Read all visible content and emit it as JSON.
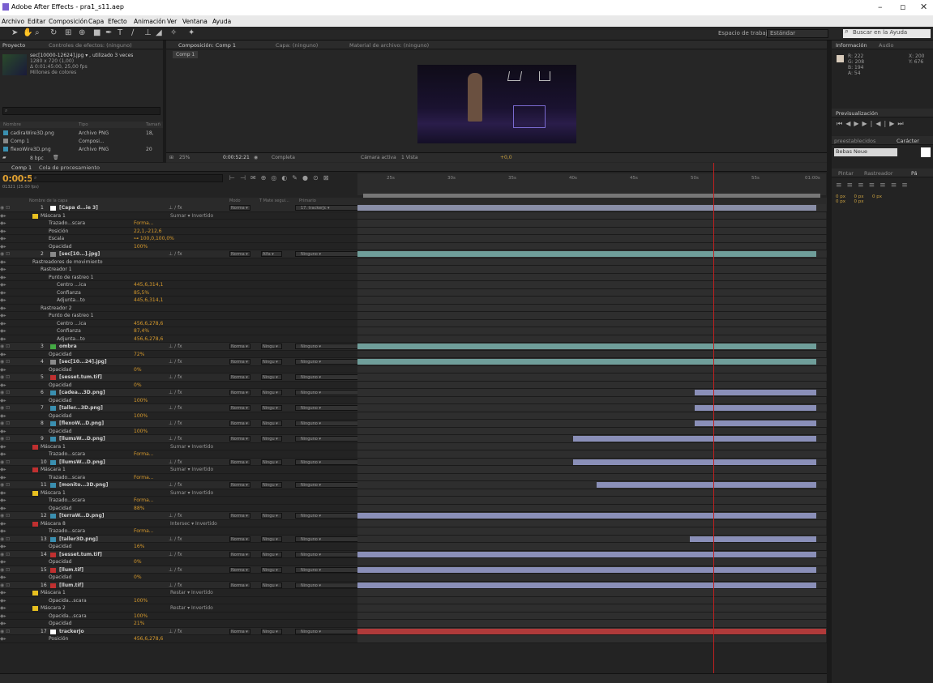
{
  "window": {
    "title": "Adobe After Effects - pra1_s11.aep"
  },
  "menu": [
    "Archivo",
    "Editar",
    "Composición",
    "Capa",
    "Efecto",
    "Animación",
    "Ver",
    "Ventana",
    "Ayuda"
  ],
  "toolbar": {
    "workspace_label": "Espacio de trabajo:",
    "workspace_value": "Estándar",
    "help_placeholder": "Buscar en la Ayuda"
  },
  "project": {
    "tab_project": "Proyecto",
    "tab_effects": "Controles de efectos: (ninguno)",
    "file_name": "sec[10000-12624].jpg ▾ , utilizado 3 veces",
    "file_dims": "1280 x 720 (1,00)",
    "file_dur": "Δ 0:01:45:00, 25,00 fps",
    "file_colors": "Millones de colores",
    "col_name": "Nombre",
    "col_type": "Tipo",
    "col_size": "Tamañ",
    "items": [
      {
        "name": "cadiraWire3D.png",
        "type": "Archivo PNG",
        "size": "18,"
      },
      {
        "name": "Comp 1",
        "type": "Composi...",
        "size": ""
      },
      {
        "name": "flexoWire3D.png",
        "type": "Archivo PNG",
        "size": "20"
      }
    ],
    "bpc": "8 bpc"
  },
  "composition": {
    "tab_comp": "Composición: Comp 1",
    "tab_layer": "Capa: (ninguno)",
    "tab_footage": "Material de archivo: (ninguno)",
    "comp_name": "Comp 1",
    "zoom": "25%",
    "time": "0:00:52:21",
    "quality": "Completa",
    "camera": "Cámara activa",
    "views": "1 Vista",
    "exposure": "+0,0"
  },
  "info": {
    "tab": "Información",
    "tab2": "Audio",
    "r": "R: 222",
    "g": "G: 208",
    "b": "B: 194",
    "a": "A: 54",
    "x": "X: 200",
    "y": "Y: 676",
    "swatch": "#d8cbbb"
  },
  "preview": {
    "tab": "Previsualización"
  },
  "presets": {
    "tab": "preestablecidos",
    "char_tab": "Carácter",
    "font": "Bebas Neue"
  },
  "paragraph": {
    "tab1": "Pintar",
    "tab2": "Rastreador",
    "tab3": "Pá",
    "vals": [
      "0 px",
      "0 px",
      "0 px",
      "0 px",
      "0 px"
    ]
  },
  "timeline": {
    "tab": "Comp 1",
    "tab2": "Cola de procesamiento",
    "timecode": "0:00:52:21",
    "fps": "01321 (25.00 fps)",
    "cols": {
      "name": "Nombre de la capa",
      "mode": "Modo",
      "trk": "T  Mate segui...",
      "parent": "Primario"
    },
    "ruler": [
      "25s",
      "30s",
      "35s",
      "40s",
      "45s",
      "50s",
      "55s",
      "01:00s"
    ]
  },
  "rows": [
    {
      "k": "layer",
      "num": "1",
      "name": "[Capa d...ie 3]",
      "chip": "#ffffff",
      "mode": "Norma",
      "parent": "17. trackerJc",
      "bar": [
        0,
        0.98
      ],
      "barc": "#8a8fa8"
    },
    {
      "k": "sub",
      "ind": 2,
      "name": "Máscara 1",
      "chip": "#e8c020",
      "extra": "Sumar ▾   Invertido"
    },
    {
      "k": "prop",
      "ind": 3,
      "name": "Trazado...scara",
      "val": "Forma..."
    },
    {
      "k": "prop",
      "ind": 3,
      "name": "Posición",
      "val": "22,1,-212,6"
    },
    {
      "k": "prop",
      "ind": 3,
      "name": "Escala",
      "val": "⊶ 100,0,100,0%"
    },
    {
      "k": "prop",
      "ind": 3,
      "name": "Opacidad",
      "val": "100%"
    },
    {
      "k": "layer",
      "num": "2",
      "name": "[sec[10...].jpg]",
      "chip": "#8a8a8a",
      "mode": "Norma",
      "trk": "Alfa",
      "parent": "Ninguno",
      "bar": [
        0,
        0.98
      ],
      "barc": "#6f9e9a"
    },
    {
      "k": "sub",
      "ind": 1,
      "name": "Rastreadores de movimiento"
    },
    {
      "k": "sub",
      "ind": 2,
      "name": "Rastreador 1"
    },
    {
      "k": "sub",
      "ind": 3,
      "name": "Punto de rastreo 1"
    },
    {
      "k": "prop",
      "ind": 4,
      "name": "Centro ...ica",
      "val": "445,6,314,1"
    },
    {
      "k": "prop",
      "ind": 4,
      "name": "Confianza",
      "val": "85,5%"
    },
    {
      "k": "prop",
      "ind": 4,
      "name": "Adjunta...to",
      "val": "445,6,314,1"
    },
    {
      "k": "sub",
      "ind": 2,
      "name": "Rastreador 2"
    },
    {
      "k": "sub",
      "ind": 3,
      "name": "Punto de rastreo 1"
    },
    {
      "k": "prop",
      "ind": 4,
      "name": "Centro ...ica",
      "val": "456,6,278,6"
    },
    {
      "k": "prop",
      "ind": 4,
      "name": "Confianza",
      "val": "87,4%"
    },
    {
      "k": "prop",
      "ind": 4,
      "name": "Adjunta...to",
      "val": "456,6,278,6"
    },
    {
      "k": "layer",
      "num": "3",
      "name": "ombra",
      "chip": "#44aa44",
      "mode": "Norma",
      "trk": "Ningu",
      "parent": "Ninguno",
      "bar": [
        0,
        0.98
      ],
      "barc": "#6f9e9a"
    },
    {
      "k": "prop",
      "ind": 3,
      "name": "Opacidad",
      "val": "72%"
    },
    {
      "k": "layer",
      "num": "4",
      "name": "[sec[10...24].jpg]",
      "chip": "#8a8a8a",
      "mode": "Norma",
      "trk": "Ningu",
      "parent": "Ninguno",
      "bar": [
        0,
        0.98
      ],
      "barc": "#6f9e9a"
    },
    {
      "k": "prop",
      "ind": 3,
      "name": "Opacidad",
      "val": "0%"
    },
    {
      "k": "layer",
      "num": "5",
      "name": "[sesset.tum.tif]",
      "chip": "#c03030",
      "mode": "Norma",
      "trk": "Ningu",
      "parent": "Ninguno"
    },
    {
      "k": "prop",
      "ind": 3,
      "name": "Opacidad",
      "val": "0%"
    },
    {
      "k": "layer",
      "num": "6",
      "name": "[cadea...3D.png]",
      "chip": "#3a8fb0",
      "mode": "Norma",
      "trk": "Ningu",
      "parent": "Ninguno",
      "bar": [
        0.72,
        0.98
      ],
      "barc": "#8a8fb8"
    },
    {
      "k": "prop",
      "ind": 3,
      "name": "Opacidad",
      "val": "100%"
    },
    {
      "k": "layer",
      "num": "7",
      "name": "[taller...3D.png]",
      "chip": "#3a8fb0",
      "mode": "Norma",
      "trk": "Ningu",
      "parent": "Ninguno",
      "bar": [
        0.72,
        0.98
      ],
      "barc": "#8a8fb8"
    },
    {
      "k": "prop",
      "ind": 3,
      "name": "Opacidad",
      "val": "100%"
    },
    {
      "k": "layer",
      "num": "8",
      "name": "[flexoW...D.png]",
      "chip": "#3a8fb0",
      "mode": "Norma",
      "trk": "Ningu",
      "parent": "Ninguno",
      "bar": [
        0.72,
        0.98
      ],
      "barc": "#8a8fb8"
    },
    {
      "k": "prop",
      "ind": 3,
      "name": "Opacidad",
      "val": "100%"
    },
    {
      "k": "layer",
      "num": "9",
      "name": "[llumsW...D.png]",
      "chip": "#3a8fb0",
      "mode": "Norma",
      "trk": "Ningu",
      "parent": "Ninguno",
      "bar": [
        0.46,
        0.98
      ],
      "barc": "#8a8fb8"
    },
    {
      "k": "sub",
      "ind": 2,
      "name": "Máscara 1",
      "chip": "#c03030",
      "extra": "Sumar ▾   Invertido"
    },
    {
      "k": "prop",
      "ind": 3,
      "name": "Trazado...scara",
      "val": "Forma..."
    },
    {
      "k": "layer",
      "num": "10",
      "name": "[llumsW...D.png]",
      "chip": "#3a8fb0",
      "mode": "Norma",
      "trk": "Ningu",
      "parent": "Ninguno",
      "bar": [
        0.46,
        0.98
      ],
      "barc": "#8a8fb8"
    },
    {
      "k": "sub",
      "ind": 2,
      "name": "Máscara 1",
      "chip": "#c03030",
      "extra": "Sumar ▾   Invertido"
    },
    {
      "k": "prop",
      "ind": 3,
      "name": "Trazado...scara",
      "val": "Forma..."
    },
    {
      "k": "layer",
      "num": "11",
      "name": "[monito...3D.png]",
      "chip": "#3a8fb0",
      "mode": "Norma",
      "trk": "Ningu",
      "parent": "Ninguno",
      "bar": [
        0.51,
        0.98
      ],
      "barc": "#8a8fb8"
    },
    {
      "k": "sub",
      "ind": 2,
      "name": "Máscara 1",
      "chip": "#e8c020",
      "extra": "Sumar ▾   Invertido"
    },
    {
      "k": "prop",
      "ind": 3,
      "name": "Trazado...scara",
      "val": "Forma..."
    },
    {
      "k": "prop",
      "ind": 3,
      "name": "Opacidad",
      "val": "88%"
    },
    {
      "k": "layer",
      "num": "12",
      "name": "[terraW...D.png]",
      "chip": "#3a8fb0",
      "mode": "Norma",
      "trk": "Ningu",
      "parent": "Ninguno",
      "bar": [
        0,
        0.98
      ],
      "barc": "#8a8fb8"
    },
    {
      "k": "sub",
      "ind": 2,
      "name": "Máscara 8",
      "chip": "#c03030",
      "extra": "Intersec ▾   Invertido"
    },
    {
      "k": "prop",
      "ind": 3,
      "name": "Trazado...scara",
      "val": "Forma..."
    },
    {
      "k": "layer",
      "num": "13",
      "name": "[taller3D.png]",
      "chip": "#3a8fb0",
      "mode": "Norma",
      "trk": "Ningu",
      "parent": "Ninguno",
      "bar": [
        0.71,
        0.98
      ],
      "barc": "#8a8fb8"
    },
    {
      "k": "prop",
      "ind": 3,
      "name": "Opacidad",
      "val": "16%"
    },
    {
      "k": "layer",
      "num": "14",
      "name": "[sesset.tum.tif]",
      "chip": "#c03030",
      "mode": "Norma",
      "trk": "Ningu",
      "parent": "Ninguno",
      "bar": [
        0,
        0.98
      ],
      "barc": "#8a8fb8"
    },
    {
      "k": "prop",
      "ind": 3,
      "name": "Opacidad",
      "val": "0%"
    },
    {
      "k": "layer",
      "num": "15",
      "name": "[llum.tif]",
      "chip": "#c03030",
      "mode": "Norma",
      "trk": "Ningu",
      "parent": "Ninguno",
      "bar": [
        0,
        0.98
      ],
      "barc": "#8a8fb8"
    },
    {
      "k": "prop",
      "ind": 3,
      "name": "Opacidad",
      "val": "0%"
    },
    {
      "k": "layer",
      "num": "16",
      "name": "[llum.tif]",
      "chip": "#c03030",
      "mode": "Norma",
      "trk": "Ningu",
      "parent": "Ninguno",
      "bar": [
        0,
        0.98
      ],
      "barc": "#8a8fb8"
    },
    {
      "k": "sub",
      "ind": 2,
      "name": "Máscara 1",
      "chip": "#e8c020",
      "extra": "Restar ▾   Invertido"
    },
    {
      "k": "prop",
      "ind": 3,
      "name": "Opacida...scara",
      "val": "100%"
    },
    {
      "k": "sub",
      "ind": 2,
      "name": "Máscara 2",
      "chip": "#e8c020",
      "extra": "Restar ▾   Invertido"
    },
    {
      "k": "prop",
      "ind": 3,
      "name": "Opacida...scara",
      "val": "100%"
    },
    {
      "k": "prop",
      "ind": 3,
      "name": "Opacidad",
      "val": "21%"
    },
    {
      "k": "layer",
      "num": "17",
      "name": "trackerJo",
      "chip": "#ffffff",
      "mode": "Norma",
      "trk": "Ningu",
      "parent": "Ninguno",
      "bar": [
        0,
        1
      ],
      "barc": "#b03a3a"
    },
    {
      "k": "prop",
      "ind": 3,
      "name": "Posición",
      "val": "456,6,278,6"
    }
  ]
}
